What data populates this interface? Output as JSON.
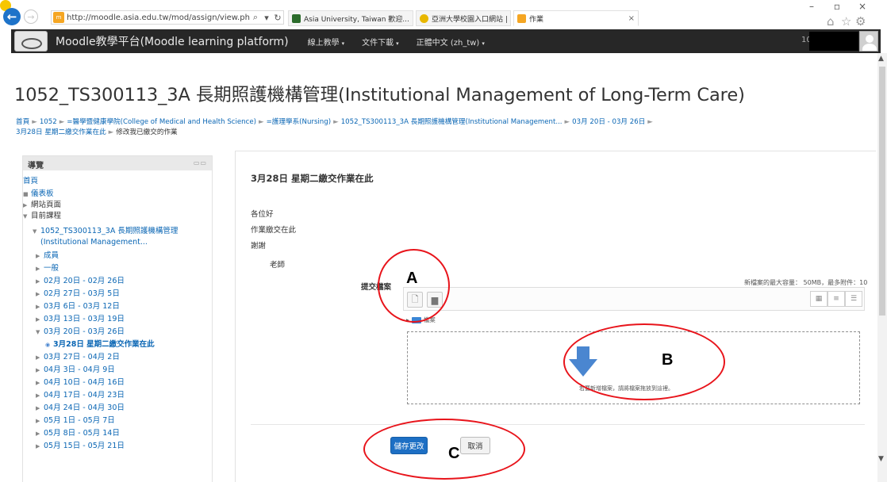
{
  "browser": {
    "address_url": "http://moodle.asia.edu.tw/mod/assign/view.php?id=20784",
    "favicon_text": "m",
    "tabs": [
      {
        "label": "Asia University, Taiwan 歡迎..."
      },
      {
        "label": "亞洲大學校園入口網站 | Asia ..."
      },
      {
        "label": "作業"
      }
    ],
    "window_controls": [
      "–",
      "▫",
      "×"
    ]
  },
  "navbar": {
    "brand": "Moodle教學平台(Moodle learning platform)",
    "menus": [
      "線上教學",
      "文件下載",
      "正體中文 (zh_tw)"
    ],
    "user_prefix": "10"
  },
  "page": {
    "title": "1052_TS300113_3A 長期照護機構管理(Institutional Management of Long-Term Care)",
    "breadcrumb": [
      "首頁",
      "1052",
      "=醫學暨健康學院(College of Medical and Health Science)",
      "=護理學系(Nursing)",
      "1052_TS300113_3A 長期照護機構管理(Institutional Management...",
      "03月 20日 - 03月 26日",
      "3月28日 星期二繳交作業在此",
      "修改我已繳交的作業"
    ]
  },
  "nav_block": {
    "header": "導覽",
    "items": [
      {
        "label": "首頁"
      },
      {
        "label": "儀表板"
      },
      {
        "label": "網站頁面"
      },
      {
        "label": "目前課程"
      },
      {
        "label": "1052_TS300113_3A 長期照護機構管理"
      },
      {
        "label": "(Institutional Management..."
      },
      {
        "label": "成員"
      },
      {
        "label": "一般"
      },
      {
        "label": "02月 20日 - 02月 26日"
      },
      {
        "label": "02月 27日 - 03月 5日"
      },
      {
        "label": "03月 6日 - 03月 12日"
      },
      {
        "label": "03月 13日 - 03月 19日"
      },
      {
        "label": "03月 20日 - 03月 26日"
      },
      {
        "label": "3月28日 星期二繳交作業在此"
      },
      {
        "label": "03月 27日 - 04月 2日"
      },
      {
        "label": "04月 3日 - 04月 9日"
      },
      {
        "label": "04月 10日 - 04月 16日"
      },
      {
        "label": "04月 17日 - 04月 23日"
      },
      {
        "label": "04月 24日 - 04月 30日"
      },
      {
        "label": "05月 1日 - 05月 7日"
      },
      {
        "label": "05月 8日 - 05月 14日"
      },
      {
        "label": "05月 15日 - 05月 21日"
      }
    ]
  },
  "assignment": {
    "title": "3月28日 星期二繳交作業在此",
    "intro": [
      "各位好",
      "作業繳交在此",
      "謝謝",
      "老師"
    ],
    "submit_label": "提交檔案",
    "max_size": "新檔案的最大容量： 50MB，最多附件：10",
    "folder_label": "檔案",
    "drop_hint": "若要新增檔案，請將檔案拖放到這裡。",
    "save_label": "儲存更改",
    "cancel_label": "取消"
  },
  "annotations": {
    "a": "A",
    "b": "B",
    "c": "C",
    "color": "#e8141b"
  },
  "colors": {
    "navbar_bg": "#272727",
    "link": "#0a66b4",
    "primary_button": "#1d6fc4",
    "drop_arrow": "#4a86d0"
  }
}
